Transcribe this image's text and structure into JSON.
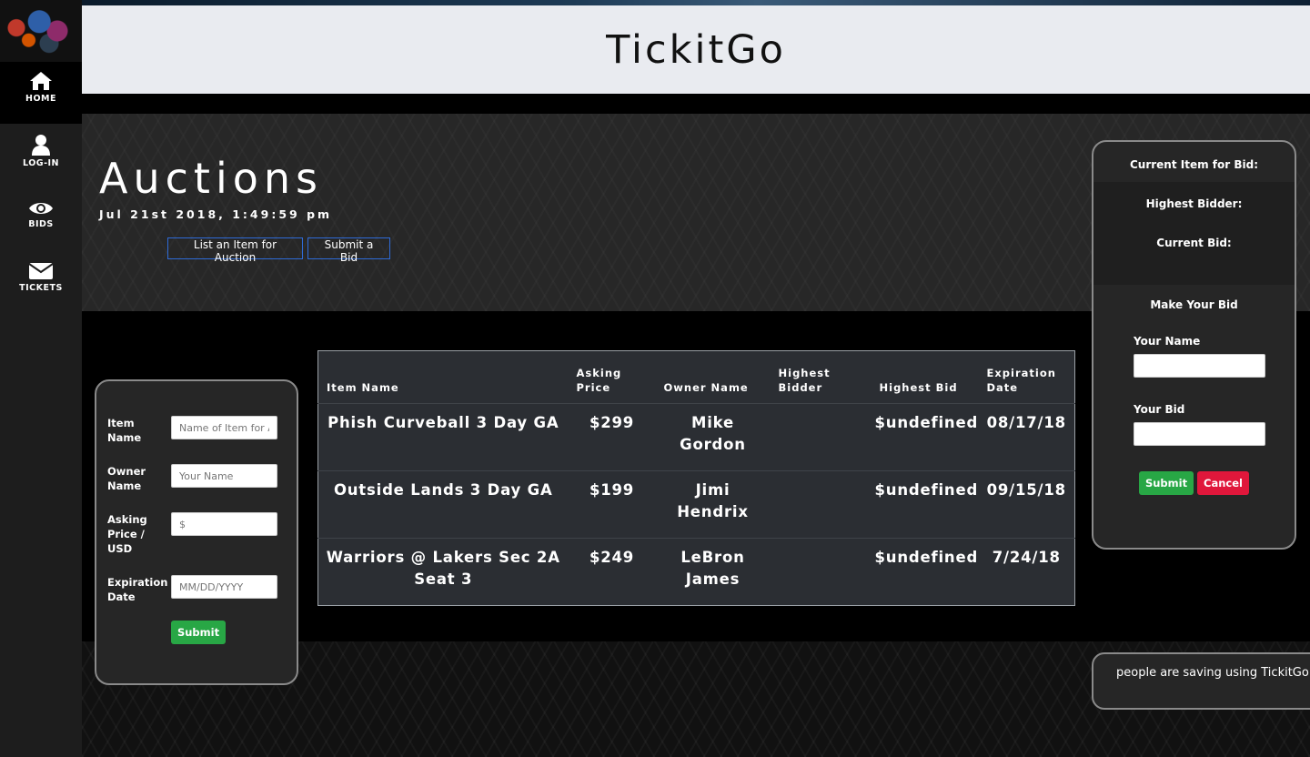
{
  "app": {
    "title": "TickitGo"
  },
  "sidebar": {
    "items": [
      {
        "label": "HOME",
        "icon": "home-icon"
      },
      {
        "label": "LOG-IN",
        "icon": "user-icon"
      },
      {
        "label": "BIDS",
        "icon": "eye-icon"
      },
      {
        "label": "TICKETS",
        "icon": "envelope-icon"
      }
    ]
  },
  "hero": {
    "title": "Auctions",
    "timestamp": "Jul 21st 2018, 1:49:59 pm",
    "list_button": "List an Item for Auction",
    "bid_button": "Submit a Bid"
  },
  "list_form": {
    "item_name_label": "Item Name",
    "item_name_placeholder": "Name of Item for Auction",
    "owner_name_label": "Owner Name",
    "owner_name_placeholder": "Your Name",
    "price_label": "Asking Price / USD",
    "price_placeholder": "$",
    "expiration_label": "Expiration Date",
    "expiration_placeholder": "MM/DD/YYYY",
    "submit_label": "Submit"
  },
  "table": {
    "headers": [
      "Item Name",
      "Asking Price",
      "Owner Name",
      "Highest Bidder",
      "Highest Bid",
      "Expiration Date"
    ],
    "rows": [
      [
        "Phish Curveball 3 Day GA",
        "$299",
        "Mike Gordon",
        "",
        "$undefined",
        "08/17/18"
      ],
      [
        "Outside Lands 3 Day GA",
        "$199",
        "Jimi Hendrix",
        "",
        "$undefined",
        "09/15/18"
      ],
      [
        "Warriors @ Lakers Sec 2A Seat 3",
        "$249",
        "LeBron James",
        "",
        "$undefined",
        "7/24/18"
      ]
    ]
  },
  "bid_panel": {
    "current_item_label": "Current Item for Bid:",
    "highest_bidder_label": "Highest Bidder:",
    "current_bid_label": "Current Bid:",
    "make_bid_heading": "Make Your Bid",
    "name_label": "Your Name",
    "bid_label": "Your Bid",
    "submit_label": "Submit",
    "cancel_label": "Cancel"
  },
  "savings": {
    "text": "people are saving using TickitGo"
  },
  "colors": {
    "accent_blue": "#2e6bd8",
    "submit_green": "#28a745",
    "cancel_red": "#e0173b",
    "header_bg": "#e9ebf0"
  }
}
